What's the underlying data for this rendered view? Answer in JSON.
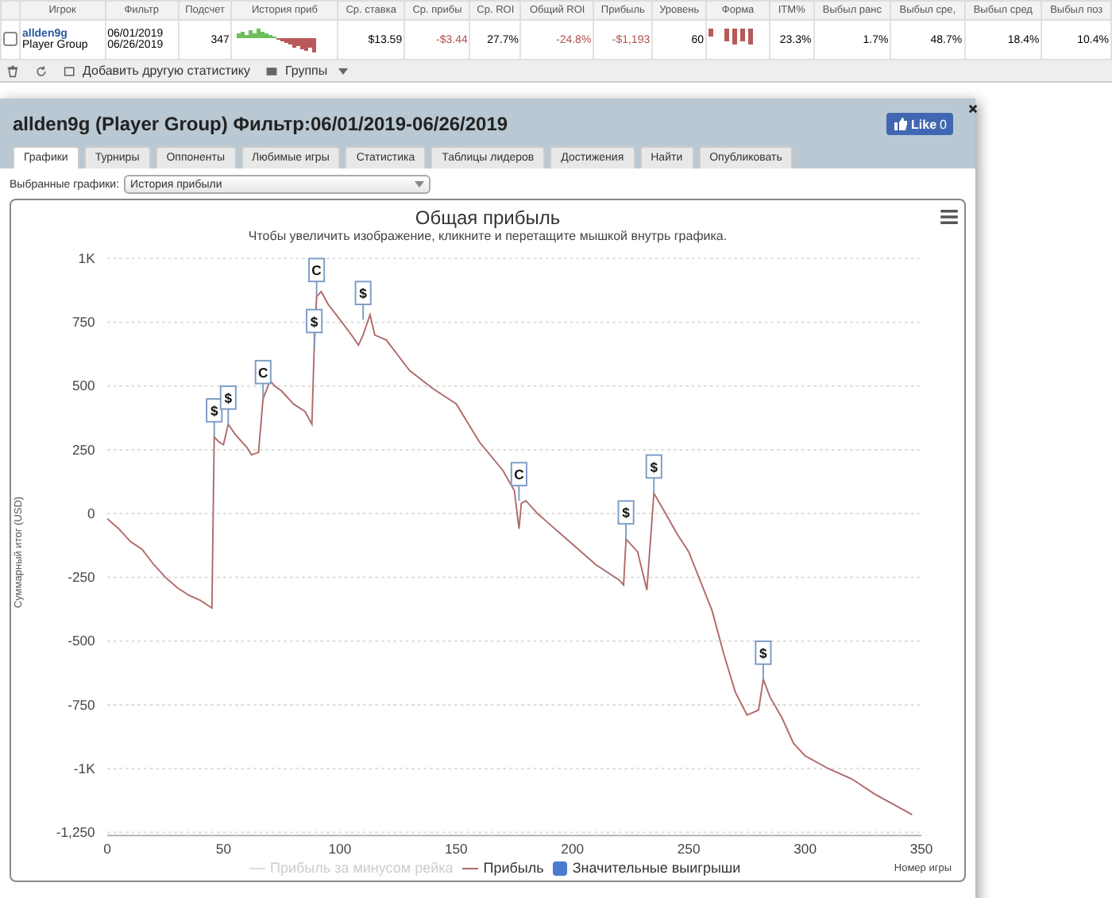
{
  "stats_table": {
    "columns": [
      "Игрок",
      "Фильтр",
      "Подсчет",
      "История приб",
      "Ср. ставка",
      "Ср. прибы",
      "Ср. ROI",
      "Общий ROI",
      "Прибыль",
      "Уровень",
      "Форма",
      "ITM%",
      "Выбыл ранс",
      "Выбыл сре,",
      "Выбыл сред",
      "Выбыл поз"
    ],
    "row": {
      "checked": false,
      "cells": [
        {
          "kind": "player",
          "lines": [
            "allden9g",
            "Player Group"
          ]
        },
        {
          "kind": "dates",
          "lines": [
            "06/01/2019",
            "06/26/2019"
          ]
        },
        {
          "kind": "text",
          "text": "347"
        },
        {
          "kind": "sparkline"
        },
        {
          "kind": "text",
          "text": "$13.59"
        },
        {
          "kind": "negative",
          "text": "-$3.44"
        },
        {
          "kind": "text",
          "text": "27.7%"
        },
        {
          "kind": "negative",
          "text": "-24.8%"
        },
        {
          "kind": "negative",
          "text": "-$1,193"
        },
        {
          "kind": "text",
          "text": "60"
        },
        {
          "kind": "form"
        },
        {
          "kind": "text",
          "text": "23.3%"
        },
        {
          "kind": "text",
          "text": "1.7%"
        },
        {
          "kind": "text",
          "text": "48.7%"
        },
        {
          "kind": "text",
          "text": "18.4%"
        },
        {
          "kind": "text",
          "text": "10.4%"
        }
      ]
    }
  },
  "toolbar": {
    "add_stat": "Добавить другую статистику",
    "groups": "Группы"
  },
  "dialog": {
    "title": "allden9g (Player Group) Фильтр:06/01/2019-06/26/2019",
    "like": "Like",
    "like_count": "0",
    "tabs": [
      {
        "label": "Графики",
        "selected": true
      },
      {
        "label": "Турниры",
        "selected": false
      },
      {
        "label": "Оппоненты",
        "selected": false
      },
      {
        "label": "Любимые игры",
        "selected": false
      },
      {
        "label": "Статистика",
        "selected": false
      },
      {
        "label": "Таблицы лидеров",
        "selected": false
      },
      {
        "label": "Достижения",
        "selected": false
      },
      {
        "label": "Найти",
        "selected": false
      },
      {
        "label": "Опубликовать",
        "selected": false
      }
    ],
    "chart_select": {
      "label": "Выбранные графики:",
      "value": "История прибыли"
    },
    "chart": {
      "subtitle": "Чтобы увеличить изображение, кликните и перетащите мышкой внутрь графика.",
      "legend": [
        {
          "label": "Прибыль за минусом рейка",
          "kind": "line",
          "disabled": true
        },
        {
          "kind": "series",
          "disabled": false
        },
        {
          "label": "Значительные выигрыши",
          "kind": "square",
          "disabled": false,
          "color": "#4a7bd0"
        }
      ],
      "chart_data": {
        "type": "line",
        "title": "Общая прибыль",
        "xlabel": "Номер игры",
        "ylabel": "Суммарный итог (USD)",
        "x": [
          0,
          5,
          10,
          15,
          20,
          25,
          30,
          35,
          40,
          45,
          46,
          48,
          50,
          52,
          55,
          60,
          62,
          65,
          67,
          70,
          72,
          75,
          80,
          85,
          88,
          89,
          90,
          92,
          95,
          100,
          105,
          108,
          110,
          113,
          115,
          120,
          125,
          130,
          140,
          150,
          160,
          170,
          175,
          177,
          178,
          180,
          185,
          190,
          200,
          210,
          220,
          222,
          223,
          228,
          232,
          235,
          240,
          245,
          250,
          260,
          265,
          270,
          275,
          280,
          282,
          285,
          290,
          295,
          300,
          310,
          320,
          330,
          340,
          346
        ],
        "series": [
          {
            "name": "Прибыль",
            "color": "#b06a6a",
            "values": [
              -20,
              -60,
              -110,
              -140,
              -200,
              -250,
              -290,
              -320,
              -340,
              -370,
              300,
              280,
              270,
              350,
              310,
              260,
              230,
              240,
              450,
              520,
              500,
              480,
              430,
              400,
              350,
              650,
              850,
              870,
              820,
              760,
              700,
              660,
              700,
              780,
              700,
              680,
              620,
              560,
              490,
              430,
              280,
              170,
              90,
              -60,
              40,
              50,
              0,
              -40,
              -120,
              -200,
              -260,
              -280,
              -100,
              -150,
              -300,
              80,
              0,
              -80,
              -150,
              -380,
              -550,
              -700,
              -790,
              -770,
              -650,
              -720,
              -800,
              -900,
              -950,
              -1000,
              -1040,
              -1100,
              -1150,
              -1180
            ]
          }
        ],
        "grid": true,
        "xlim": [
          0,
          350
        ],
        "ylim": [
          -1250,
          1000
        ],
        "xticks": [
          0,
          50,
          100,
          150,
          200,
          250,
          300,
          350
        ],
        "yticks": [
          {
            "value": 1000,
            "label": "1K"
          },
          750,
          500,
          250,
          0,
          -250,
          -500,
          -750,
          {
            "value": -1000,
            "label": "-1K"
          },
          {
            "value": -1250,
            "label": "-1,250"
          }
        ],
        "annotations": [
          {
            "x": 46,
            "y": 300,
            "text": "$"
          },
          {
            "x": 52,
            "y": 350,
            "text": "$"
          },
          {
            "x": 67,
            "y": 450,
            "text": "C"
          },
          {
            "x": 89,
            "y": 650,
            "text": "$"
          },
          {
            "x": 90,
            "y": 850,
            "text": "C"
          },
          {
            "x": 110,
            "y": 760,
            "text": "$"
          },
          {
            "x": 177,
            "y": 50,
            "text": "C"
          },
          {
            "x": 223,
            "y": -100,
            "text": "$"
          },
          {
            "x": 235,
            "y": 80,
            "text": "$"
          },
          {
            "x": 282,
            "y": -650,
            "text": "$"
          }
        ]
      }
    }
  }
}
